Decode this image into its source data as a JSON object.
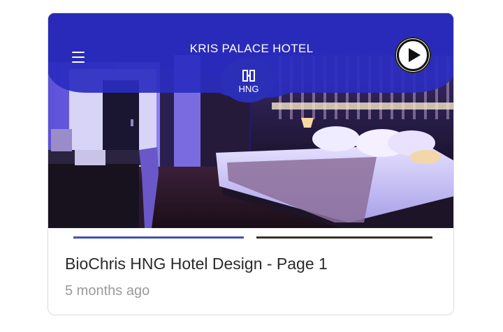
{
  "thumbnail": {
    "hotel_name": "KRIS PALACE HOTEL",
    "logo_text": "HNG",
    "accent_color": "#2a2cc0",
    "menu_icon": "hamburger-menu-icon",
    "play_icon": "play-icon"
  },
  "card": {
    "title": "BioChris HNG Hotel Design - Page 1",
    "timestamp": "5 months ago"
  }
}
